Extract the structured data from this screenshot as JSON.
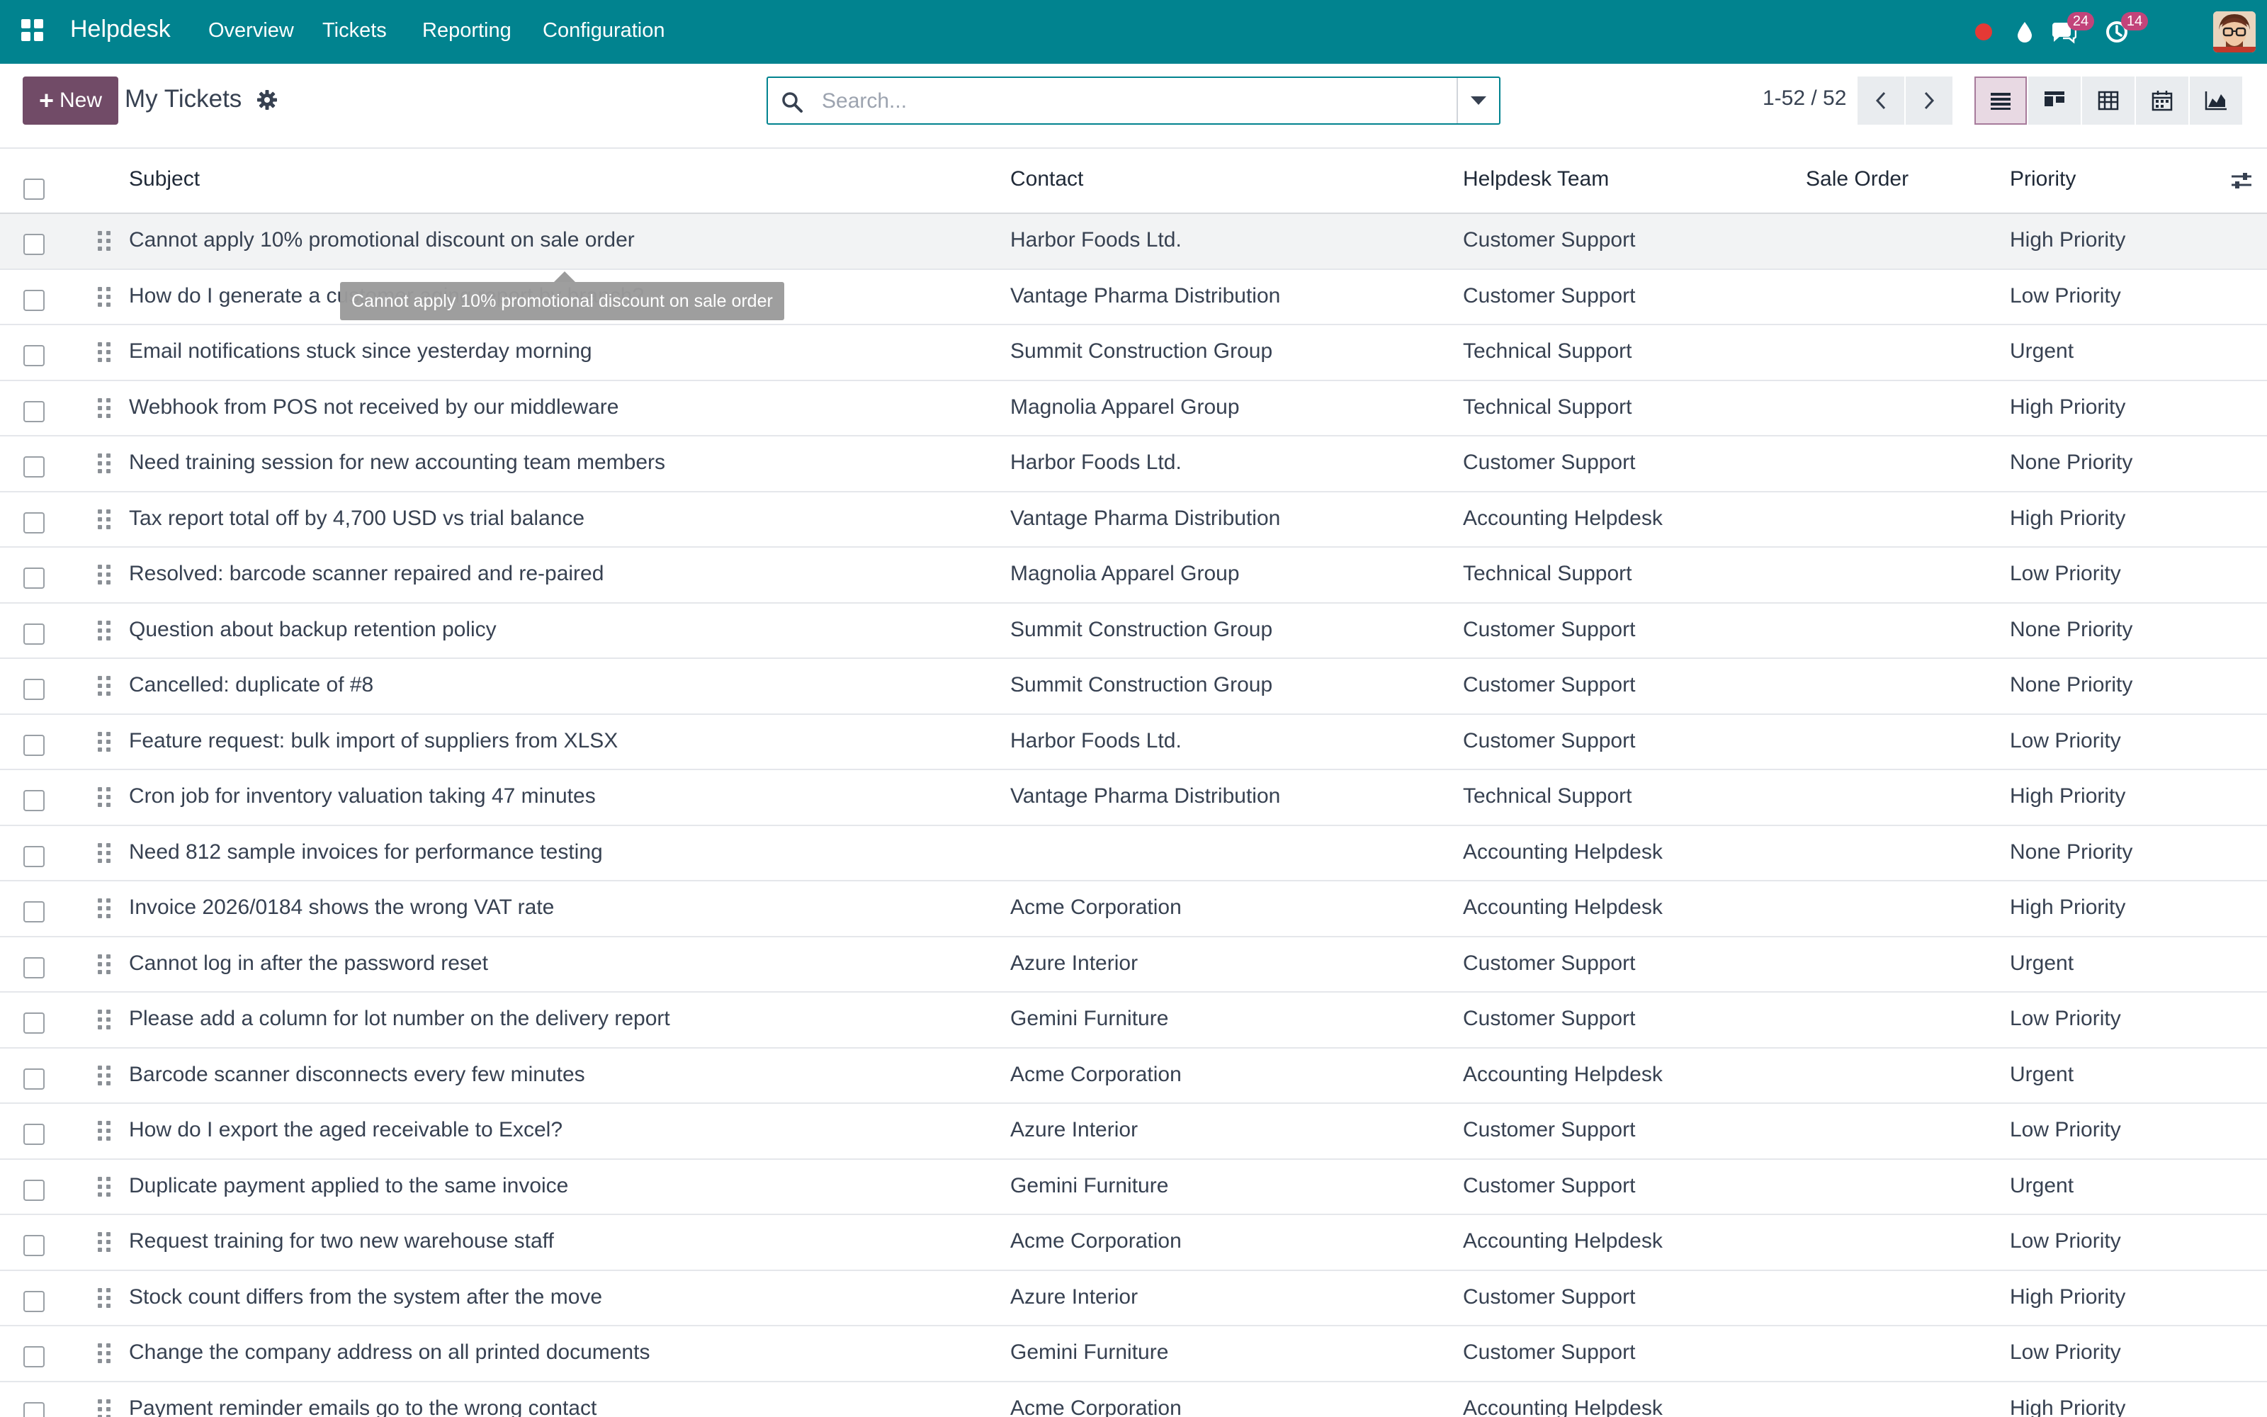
{
  "navbar": {
    "app_name": "Helpdesk",
    "menu": [
      "Overview",
      "Tickets",
      "Reporting",
      "Configuration"
    ],
    "icons": [
      "apps-grid-icon",
      "record-dot-icon",
      "droplet-icon",
      "chat-icon",
      "clock-activity-icon",
      "user-avatar"
    ],
    "messages_count": "24",
    "activities_count": "14",
    "brand_color": "#01838f"
  },
  "control_panel": {
    "new_label": "New",
    "breadcrumb": "My Tickets",
    "search_placeholder": "Search...",
    "pager": "1-52 / 52",
    "views": [
      "list-view-icon",
      "kanban-view-icon",
      "pivot-view-icon",
      "calendar-view-icon",
      "graph-view-icon"
    ],
    "active_view": "list",
    "new_button_color": "#714b67"
  },
  "columns": {
    "subject": "Subject",
    "contact": "Contact",
    "team": "Helpdesk Team",
    "sale_order": "Sale Order",
    "priority": "Priority"
  },
  "rows": [
    {
      "subject": "Cannot apply 10% promotional discount on sale order",
      "contact": "Harbor Foods Ltd.",
      "team": "Customer Support",
      "sale_order": "",
      "priority": "High Priority"
    },
    {
      "subject": "How do I generate a customer aging report by branch?",
      "contact": "Vantage Pharma Distribution",
      "team": "Customer Support",
      "sale_order": "",
      "priority": "Low Priority"
    },
    {
      "subject": "Email notifications stuck since yesterday morning",
      "contact": "Summit Construction Group",
      "team": "Technical Support",
      "sale_order": "",
      "priority": "Urgent"
    },
    {
      "subject": "Webhook from POS not received by our middleware",
      "contact": "Magnolia Apparel Group",
      "team": "Technical Support",
      "sale_order": "",
      "priority": "High Priority"
    },
    {
      "subject": "Need training session for new accounting team members",
      "contact": "Harbor Foods Ltd.",
      "team": "Customer Support",
      "sale_order": "",
      "priority": "None Priority"
    },
    {
      "subject": "Tax report total off by 4,700 USD vs trial balance",
      "contact": "Vantage Pharma Distribution",
      "team": "Accounting Helpdesk",
      "sale_order": "",
      "priority": "High Priority"
    },
    {
      "subject": "Resolved: barcode scanner repaired and re-paired",
      "contact": "Magnolia Apparel Group",
      "team": "Technical Support",
      "sale_order": "",
      "priority": "Low Priority"
    },
    {
      "subject": "Question about backup retention policy",
      "contact": "Summit Construction Group",
      "team": "Customer Support",
      "sale_order": "",
      "priority": "None Priority"
    },
    {
      "subject": "Cancelled: duplicate of #8",
      "contact": "Summit Construction Group",
      "team": "Customer Support",
      "sale_order": "",
      "priority": "None Priority"
    },
    {
      "subject": "Feature request: bulk import of suppliers from XLSX",
      "contact": "Harbor Foods Ltd.",
      "team": "Customer Support",
      "sale_order": "",
      "priority": "Low Priority"
    },
    {
      "subject": "Cron job for inventory valuation taking 47 minutes",
      "contact": "Vantage Pharma Distribution",
      "team": "Technical Support",
      "sale_order": "",
      "priority": "High Priority"
    },
    {
      "subject": "Need 812 sample invoices for performance testing",
      "contact": "",
      "team": "Accounting Helpdesk",
      "sale_order": "",
      "priority": "None Priority"
    },
    {
      "subject": "Invoice 2026/0184 shows the wrong VAT rate",
      "contact": "Acme Corporation",
      "team": "Accounting Helpdesk",
      "sale_order": "",
      "priority": "High Priority"
    },
    {
      "subject": "Cannot log in after the password reset",
      "contact": "Azure Interior",
      "team": "Customer Support",
      "sale_order": "",
      "priority": "Urgent"
    },
    {
      "subject": "Please add a column for lot number on the delivery report",
      "contact": "Gemini Furniture",
      "team": "Customer Support",
      "sale_order": "",
      "priority": "Low Priority"
    },
    {
      "subject": "Barcode scanner disconnects every few minutes",
      "contact": "Acme Corporation",
      "team": "Accounting Helpdesk",
      "sale_order": "",
      "priority": "Urgent"
    },
    {
      "subject": "How do I export the aged receivable to Excel?",
      "contact": "Azure Interior",
      "team": "Customer Support",
      "sale_order": "",
      "priority": "Low Priority"
    },
    {
      "subject": "Duplicate payment applied to the same invoice",
      "contact": "Gemini Furniture",
      "team": "Customer Support",
      "sale_order": "",
      "priority": "Urgent"
    },
    {
      "subject": "Request training for two new warehouse staff",
      "contact": "Acme Corporation",
      "team": "Accounting Helpdesk",
      "sale_order": "",
      "priority": "Low Priority"
    },
    {
      "subject": "Stock count differs from the system after the move",
      "contact": "Azure Interior",
      "team": "Customer Support",
      "sale_order": "",
      "priority": "High Priority"
    },
    {
      "subject": "Change the company address on all printed documents",
      "contact": "Gemini Furniture",
      "team": "Customer Support",
      "sale_order": "",
      "priority": "Low Priority"
    },
    {
      "subject": "Payment reminder emails go to the wrong contact",
      "contact": "Acme Corporation",
      "team": "Accounting Helpdesk",
      "sale_order": "",
      "priority": "High Priority"
    }
  ],
  "tooltip": "Cannot apply 10% promotional discount on sale order"
}
